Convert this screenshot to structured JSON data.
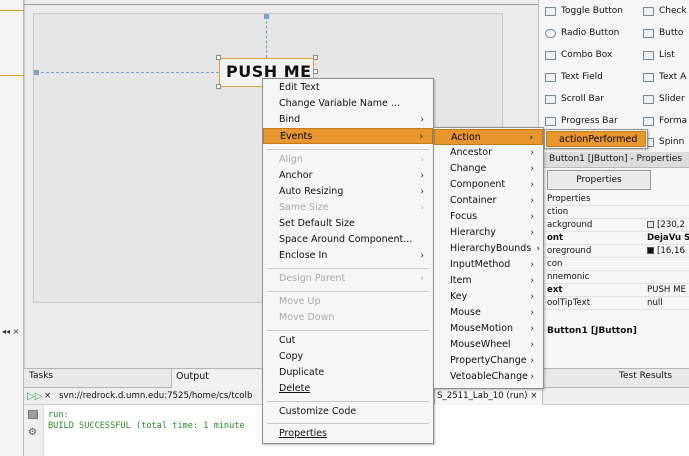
{
  "designer": {
    "button_text": "PUSH ME"
  },
  "palette": {
    "items": [
      {
        "label": "Toggle Button",
        "icon": "toggle-button-icon"
      },
      {
        "label": "Check",
        "icon": "checkbox-icon"
      },
      {
        "label": "Radio Button",
        "icon": "radio-button-icon"
      },
      {
        "label": "Butto",
        "icon": "button-group-icon"
      },
      {
        "label": "Combo Box",
        "icon": "combo-box-icon"
      },
      {
        "label": "List",
        "icon": "list-icon"
      },
      {
        "label": "Text Field",
        "icon": "text-field-icon"
      },
      {
        "label": "Text A",
        "icon": "text-area-icon"
      },
      {
        "label": "Scroll Bar",
        "icon": "scroll-bar-icon"
      },
      {
        "label": "Slider",
        "icon": "slider-icon"
      },
      {
        "label": "Progress Bar",
        "icon": "progress-bar-icon"
      },
      {
        "label": "Forma",
        "icon": "formatted-field-icon"
      },
      {
        "label": "Spinn",
        "icon": "spinner-icon"
      }
    ]
  },
  "context_menu": {
    "items": [
      {
        "label": "Edit Text",
        "disabled": false,
        "submenu": false
      },
      {
        "label": "Change Variable Name ...",
        "disabled": false,
        "submenu": false
      },
      {
        "label": "Bind",
        "disabled": false,
        "submenu": true
      },
      {
        "label": "Events",
        "disabled": false,
        "submenu": true,
        "highlighted": true
      },
      {
        "label": "Align",
        "disabled": true,
        "submenu": true
      },
      {
        "label": "Anchor",
        "disabled": false,
        "submenu": true
      },
      {
        "label": "Auto Resizing",
        "disabled": false,
        "submenu": true
      },
      {
        "label": "Same Size",
        "disabled": true,
        "submenu": true
      },
      {
        "label": "Set Default Size",
        "disabled": false,
        "submenu": false
      },
      {
        "label": "Space Around Component...",
        "disabled": false,
        "submenu": false
      },
      {
        "label": "Enclose In",
        "disabled": false,
        "submenu": true
      },
      {
        "label": "Design Parent",
        "disabled": true,
        "submenu": true
      },
      {
        "label": "Move Up",
        "disabled": true,
        "submenu": false
      },
      {
        "label": "Move Down",
        "disabled": true,
        "submenu": false
      },
      {
        "label": "Cut",
        "disabled": false,
        "submenu": false
      },
      {
        "label": "Copy",
        "disabled": false,
        "submenu": false
      },
      {
        "label": "Duplicate",
        "disabled": false,
        "submenu": false
      },
      {
        "label": "Delete",
        "disabled": false,
        "submenu": false
      },
      {
        "label": "Customize Code",
        "disabled": false,
        "submenu": false
      },
      {
        "label": "Properties",
        "disabled": false,
        "submenu": false
      }
    ]
  },
  "events_menu": {
    "items": [
      {
        "label": "Action",
        "highlighted": true
      },
      {
        "label": "Ancestor"
      },
      {
        "label": "Change"
      },
      {
        "label": "Component"
      },
      {
        "label": "Container"
      },
      {
        "label": "Focus"
      },
      {
        "label": "Hierarchy"
      },
      {
        "label": "HierarchyBounds"
      },
      {
        "label": "InputMethod"
      },
      {
        "label": "Item"
      },
      {
        "label": "Key"
      },
      {
        "label": "Mouse"
      },
      {
        "label": "MouseMotion"
      },
      {
        "label": "MouseWheel"
      },
      {
        "label": "PropertyChange"
      },
      {
        "label": "VetoableChange"
      }
    ]
  },
  "action_menu": {
    "items": [
      {
        "label": "actionPerformed"
      }
    ]
  },
  "properties": {
    "title": "Button1 [JButton] - Properties",
    "tab": "Properties",
    "section": "Properties",
    "rows": [
      {
        "name": "ction",
        "value": "",
        "bold": false
      },
      {
        "name": "ackground",
        "value": "[230,2",
        "bold": false,
        "swatch": "#e6e6e6"
      },
      {
        "name": "ont",
        "value": "DejaVu S",
        "bold": true
      },
      {
        "name": "oreground",
        "value": "[16,16",
        "bold": false,
        "swatch": "#101010"
      },
      {
        "name": "con",
        "value": "",
        "bold": false
      },
      {
        "name": "nnemonic",
        "value": "",
        "bold": false
      },
      {
        "name": "ext",
        "value": "PUSH ME",
        "bold": true
      },
      {
        "name": "oolTipText",
        "value": "null",
        "bold": false
      }
    ],
    "footer": "Button1 [JButton]"
  },
  "bottom": {
    "tasks_tab": "Tasks",
    "output_tab": "Output",
    "test_tab": "Test Results",
    "svn_path": "svn://redrock.d.umn.edu:7525/home/cs/tcolb",
    "run_tab": "S_2511_Lab_10 (run)",
    "run_tab_close": "×",
    "close_x": "×",
    "output_lines": [
      "run:",
      "BUILD SUCCESSFUL (total time: 1 minute"
    ]
  },
  "left_strip": {
    "closer": "◂◂ ×"
  }
}
